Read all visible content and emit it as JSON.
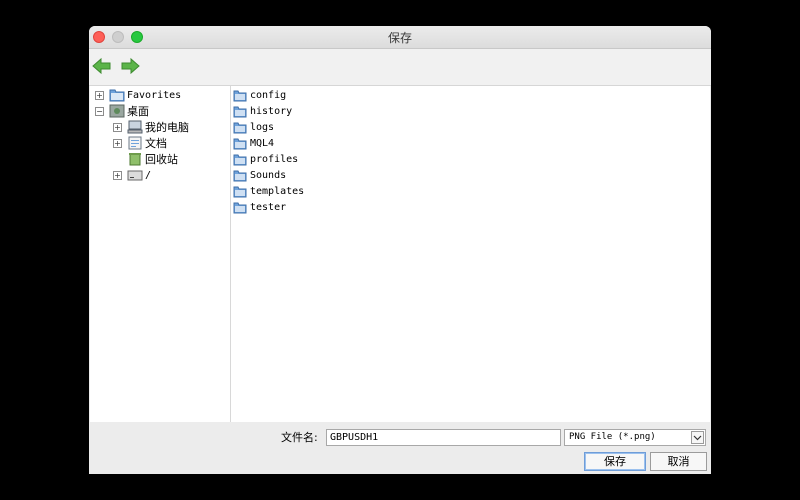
{
  "window": {
    "title": "保存"
  },
  "toolbar": {
    "back_icon": "back-arrow-icon",
    "forward_icon": "forward-arrow-icon"
  },
  "tree": {
    "items": [
      {
        "label": "Favorites",
        "expander": "+",
        "icon": "folder-icon"
      },
      {
        "label": "桌面",
        "expander": "−",
        "icon": "desktop-icon"
      },
      {
        "label": "我的电脑",
        "expander": "+",
        "icon": "computer-icon"
      },
      {
        "label": "文档",
        "expander": "+",
        "icon": "documents-icon"
      },
      {
        "label": "回收站",
        "expander": "",
        "icon": "recycle-bin-icon"
      },
      {
        "label": "/",
        "expander": "+",
        "icon": "drive-icon"
      }
    ]
  },
  "files": {
    "items": [
      {
        "label": "config"
      },
      {
        "label": "history"
      },
      {
        "label": "logs"
      },
      {
        "label": "MQL4"
      },
      {
        "label": "profiles"
      },
      {
        "label": "Sounds"
      },
      {
        "label": "templates"
      },
      {
        "label": "tester"
      }
    ]
  },
  "footer": {
    "filename_label": "文件名:",
    "filename_value": "GBPUSDH1",
    "filter_value": "PNG File (*.png)",
    "save_label": "保存",
    "cancel_label": "取消"
  },
  "colors": {
    "folder_blue": "#6fa3dc",
    "arrow_green": "#5bb449",
    "close_red": "#fe5f57",
    "max_green": "#28c840"
  }
}
